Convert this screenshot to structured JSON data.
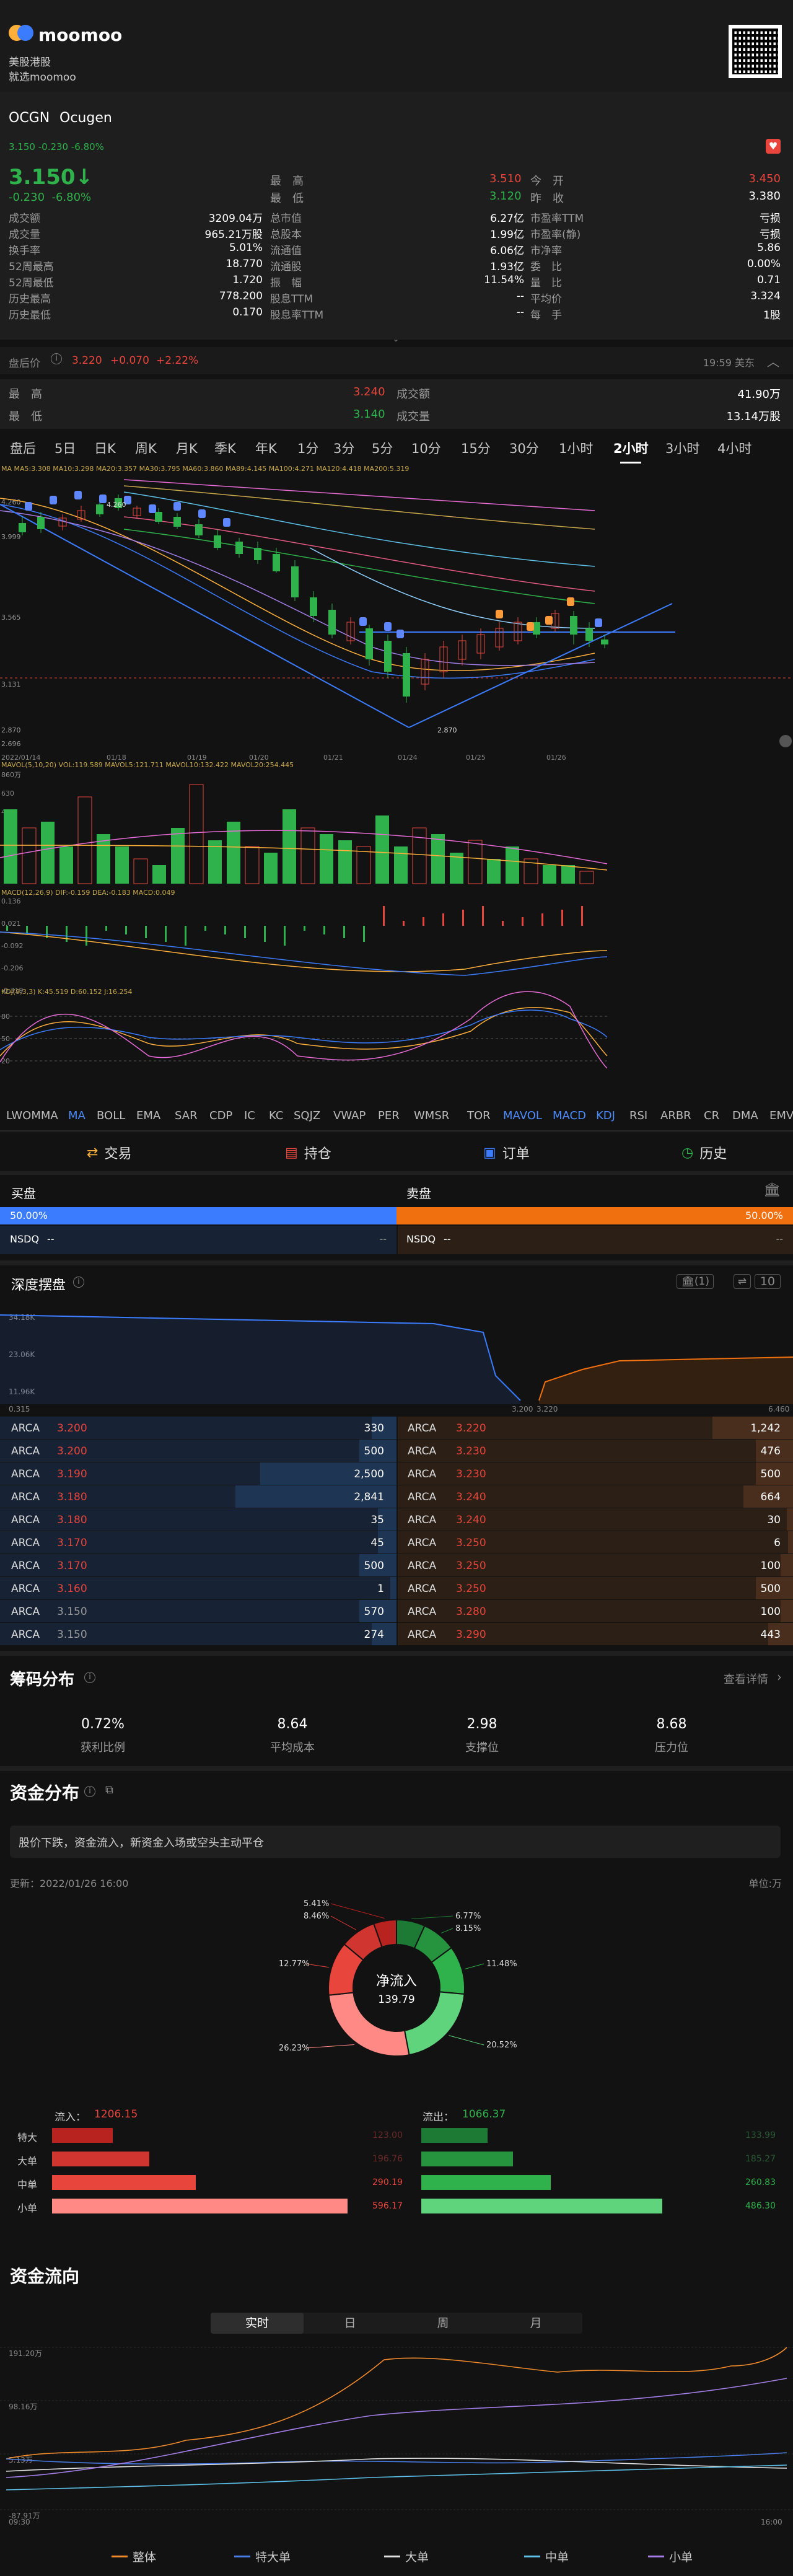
{
  "header": {
    "app_name": "moomoo",
    "line1": "美股港股",
    "line2": "就选moomoo"
  },
  "stock": {
    "ticker": "OCGN",
    "name": "Ocugen",
    "mini_quote": "3.150",
    "mini_change": "-0.230",
    "mini_pct": "-6.80%",
    "price": "3.150",
    "price_arrow": "↓",
    "change": "-0.230",
    "pct": "-6.80%",
    "high_label": "最　高",
    "high": "3.510",
    "open_label": "今　开",
    "open": "3.450",
    "low_label": "最　低",
    "low": "3.120",
    "prev_label": "昨　收",
    "prev": "3.380",
    "rows": [
      {
        "l1": "成交额",
        "v1": "3209.04万",
        "l2": "总市值",
        "v2": "6.27亿",
        "l3": "市盈率TTM",
        "v3": "亏损"
      },
      {
        "l1": "成交量",
        "v1": "965.21万股",
        "l2": "总股本",
        "v2": "1.99亿",
        "l3": "市盈率(静)",
        "v3": "亏损"
      },
      {
        "l1": "换手率",
        "v1": "5.01%",
        "l2": "流通值",
        "v2": "6.06亿",
        "l3": "市净率",
        "v3": "5.86"
      },
      {
        "l1": "52周最高",
        "v1": "18.770",
        "l2": "流通股",
        "v2": "1.93亿",
        "l3": "委　比",
        "v3": "0.00%"
      },
      {
        "l1": "52周最低",
        "v1": "1.720",
        "l2": "振　幅",
        "v2": "11.54%",
        "l3": "量　比",
        "v3": "0.71"
      },
      {
        "l1": "历史最高",
        "v1": "778.200",
        "l2": "股息TTM",
        "v2": "--",
        "l3": "平均价",
        "v3": "3.324"
      },
      {
        "l1": "历史最低",
        "v1": "0.170",
        "l2": "股息率TTM",
        "v2": "--",
        "l3": "每　手",
        "v3": "1股"
      }
    ]
  },
  "premarket": {
    "label": "盘后价",
    "price": "3.220",
    "change": "+0.070",
    "pct": "+2.22%",
    "time": "19:59 美东",
    "high_label": "最　高",
    "high": "3.240",
    "low_label": "最　低",
    "low": "3.140",
    "amount_label": "成交额",
    "amount": "41.90万",
    "volume_label": "成交量",
    "volume": "13.14万股"
  },
  "chart_tabs": [
    "盘后",
    "5日",
    "日K",
    "周K",
    "月K",
    "季K",
    "年K",
    "1分",
    "3分",
    "5分",
    "10分",
    "15分",
    "30分",
    "1小时",
    "2小时",
    "3小时",
    "4小时"
  ],
  "chart_active_tab": "2小时",
  "chart_legend": {
    "ma": "MA  MA5:3.308  MA10:3.298  MA20:3.357  MA30:3.795  MA60:3.860  MA89:4.145  MA100:4.271  MA120:4.418  MA200:5.319",
    "price_labels": [
      "4.260",
      "3.999",
      "3.565",
      "3.131",
      "2.870",
      "2.696"
    ],
    "dates": [
      "2022/01/14",
      "01/18",
      "01/19",
      "01/20",
      "01/21",
      "01/24",
      "01/25",
      "01/26"
    ],
    "mavol": "MAVOL(5,10,20)  VOL:119.589  MAVOL5:121.711  MAVOL10:132.422  MAVOL20:254.445",
    "vol_labels": [
      "860万",
      "630",
      "420"
    ],
    "macd": "MACD(12,26,9)  DIF:-0.159  DEA:-0.183  MACD:0.049",
    "macd_labels": [
      "0.136",
      "0.021",
      "-0.092",
      "-0.206",
      "-0.319"
    ],
    "kdj": "KDJ(9,3,3)  K:45.519  D:60.152  J:16.254",
    "kdj_labels": [
      "80",
      "50",
      "20"
    ]
  },
  "indicators": [
    "LWOMMA",
    "MA",
    "BOLL",
    "EMA",
    "SAR",
    "CDP",
    "IC",
    "KC",
    "SQJZ",
    "VWAP",
    "PER",
    "WMSR",
    "TOR",
    "MAVOL",
    "MACD",
    "KDJ",
    "RSI",
    "ARBR",
    "CR",
    "DMA",
    "EMV"
  ],
  "indicators_active": [
    "MA",
    "MAVOL",
    "MACD",
    "KDJ"
  ],
  "actions": [
    {
      "icon": "trade-icon",
      "label": "交易"
    },
    {
      "icon": "position-icon",
      "label": "持仓"
    },
    {
      "icon": "order-icon",
      "label": "订单"
    },
    {
      "icon": "history-icon",
      "label": "历史"
    }
  ],
  "buy_sell": {
    "buy_label": "买盘",
    "sell_label": "卖盘",
    "buy_pct": "50.00%",
    "sell_pct": "50.00%",
    "buy_exchange": "NSDQ",
    "buy_value": "--",
    "buy_value2": "--",
    "sell_exchange": "NSDQ",
    "sell_value": "--",
    "sell_value2": "--"
  },
  "depth": {
    "title": "深度摆盘",
    "exchange_badge": "(1)",
    "levels": "10",
    "y_labels": [
      "34.18K",
      "23.06K",
      "11.96K"
    ],
    "x_labels": [
      "0.315",
      "3.200",
      "3.220",
      "6.460"
    ],
    "bids": [
      {
        "ex": "ARCA",
        "price": "3.200",
        "size": "330"
      },
      {
        "ex": "ARCA",
        "price": "3.200",
        "size": "500"
      },
      {
        "ex": "ARCA",
        "price": "3.190",
        "size": "2,500"
      },
      {
        "ex": "ARCA",
        "price": "3.180",
        "size": "2,841"
      },
      {
        "ex": "ARCA",
        "price": "3.180",
        "size": "35"
      },
      {
        "ex": "ARCA",
        "price": "3.170",
        "size": "45"
      },
      {
        "ex": "ARCA",
        "price": "3.170",
        "size": "500"
      },
      {
        "ex": "ARCA",
        "price": "3.160",
        "size": "1"
      },
      {
        "ex": "ARCA",
        "price": "3.150",
        "size": "570"
      },
      {
        "ex": "ARCA",
        "price": "3.150",
        "size": "274"
      }
    ],
    "asks": [
      {
        "ex": "ARCA",
        "price": "3.220",
        "size": "1,242"
      },
      {
        "ex": "ARCA",
        "price": "3.230",
        "size": "476"
      },
      {
        "ex": "ARCA",
        "price": "3.230",
        "size": "500"
      },
      {
        "ex": "ARCA",
        "price": "3.240",
        "size": "664"
      },
      {
        "ex": "ARCA",
        "price": "3.240",
        "size": "30"
      },
      {
        "ex": "ARCA",
        "price": "3.250",
        "size": "6"
      },
      {
        "ex": "ARCA",
        "price": "3.250",
        "size": "100"
      },
      {
        "ex": "ARCA",
        "price": "3.250",
        "size": "500"
      },
      {
        "ex": "ARCA",
        "price": "3.280",
        "size": "100"
      },
      {
        "ex": "ARCA",
        "price": "3.290",
        "size": "443"
      }
    ]
  },
  "chips": {
    "title": "筹码分布",
    "detail_link": "查看详情",
    "stats": [
      {
        "value": "0.72%",
        "label": "获利比例"
      },
      {
        "value": "8.64",
        "label": "平均成本"
      },
      {
        "value": "2.98",
        "label": "支撑位"
      },
      {
        "value": "8.68",
        "label": "压力位"
      }
    ]
  },
  "capital": {
    "title": "资金分布",
    "summary": "股价下跌，资金流入，新资金入场或空头主动平仓",
    "updated": "更新：2022/01/26 16:00",
    "unit": "单位:万",
    "center_label": "净流入",
    "center_value": "139.79",
    "slice_labels": [
      "5.41%",
      "8.46%",
      "12.77%",
      "26.23%",
      "6.77%",
      "8.15%",
      "11.48%",
      "20.52%"
    ],
    "inflow_label": "流入：",
    "inflow_total": "1206.15",
    "outflow_label": "流出：",
    "outflow_total": "1066.37",
    "categories": [
      {
        "label": "特大",
        "in": "123.00",
        "out": "133.99"
      },
      {
        "label": "大单",
        "in": "196.76",
        "out": "185.27"
      },
      {
        "label": "中单",
        "in": "290.19",
        "out": "260.83"
      },
      {
        "label": "小单",
        "in": "596.17",
        "out": "486.30"
      }
    ],
    "colors": {
      "in_dark": "#b8221f",
      "in_mid": "#e8453c",
      "in_light": "#ff8a85",
      "out_dark": "#1d7a35",
      "out_mid": "#2fb24b",
      "out_light": "#5fd47c"
    }
  },
  "flow": {
    "title": "资金流向",
    "tabs": [
      "实时",
      "日",
      "周",
      "月"
    ],
    "active_tab": "实时",
    "y_labels": [
      "191.20万",
      "98.16万",
      "5.13万",
      "-87.91万"
    ],
    "x_labels": [
      "09:30",
      "16:00"
    ],
    "legend": [
      {
        "label": "整体",
        "color": "#f08a2c"
      },
      {
        "label": "特大单",
        "color": "#4a7ee8"
      },
      {
        "label": "大单",
        "color": "#e0e0e0"
      },
      {
        "label": "中单",
        "color": "#5cc0e8"
      },
      {
        "label": "小单",
        "color": "#a47ee8"
      }
    ]
  }
}
